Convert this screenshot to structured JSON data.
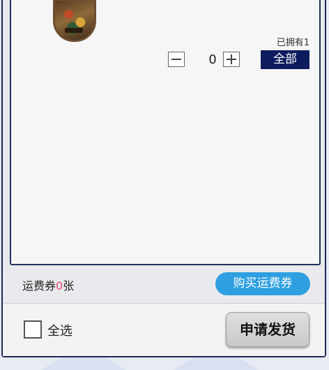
{
  "item": {
    "owned_text": "已拥有1",
    "quantity": "0",
    "all_label": "全部"
  },
  "coupon": {
    "prefix": "运费券",
    "count": "0",
    "suffix": "张",
    "buy_label": "购买运费券"
  },
  "footer": {
    "select_all_label": "全选",
    "apply_label": "申请发货"
  },
  "colors": {
    "all_button": "#0e1c5e",
    "buy_button": "#2e9fe0",
    "count_highlight": "#e24b6d"
  }
}
